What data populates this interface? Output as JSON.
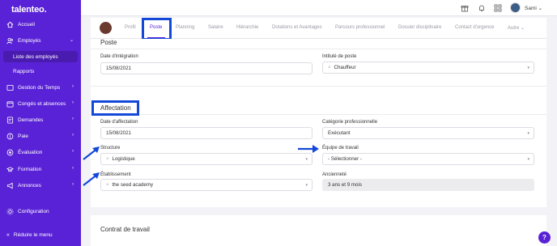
{
  "sidebar": {
    "logo": "talenteo.",
    "items": [
      {
        "label": "Accueil",
        "icon": "home-icon"
      },
      {
        "label": "Employés",
        "icon": "users-icon"
      },
      {
        "label": "Liste des employés"
      },
      {
        "label": "Rapports"
      },
      {
        "label": "Gestion du Temps",
        "icon": "clock-icon"
      },
      {
        "label": "Congés et absences",
        "icon": "calendar-icon"
      },
      {
        "label": "Demandes",
        "icon": "inbox-icon"
      },
      {
        "label": "Paie",
        "icon": "money-icon"
      },
      {
        "label": "Évaluation",
        "icon": "target-icon"
      },
      {
        "label": "Formation",
        "icon": "graduation-icon"
      },
      {
        "label": "Annonces",
        "icon": "megaphone-icon"
      },
      {
        "label": "Configuration",
        "icon": "gear-icon"
      }
    ],
    "reduce_label": "Réduire le menu"
  },
  "topbar": {
    "user_name": "Sami"
  },
  "tabs": [
    "Profil",
    "Poste",
    "Planning",
    "Salaire",
    "Hiérarchie",
    "Dotations et Avantages",
    "Parcours professionnel",
    "Dossier disciplinaire",
    "Contact d'urgence",
    "Autre"
  ],
  "active_tab": "Poste",
  "poste": {
    "title": "Poste",
    "date_integration_label": "Date d'intégration",
    "date_integration_value": "15/08/2021",
    "intitule_label": "Intitulé de poste",
    "intitule_value": "Chauffeur"
  },
  "affectation": {
    "title": "Affectation",
    "date_affectation_label": "Date d'affectation",
    "date_affectation_value": "15/08/2021",
    "categorie_label": "Catégorie professionnelle",
    "categorie_value": "Exécutant",
    "structure_label": "Structure",
    "structure_value": "Logistique",
    "equipe_label": "Équipe de travail",
    "equipe_value": "- Sélectionner -",
    "etablissement_label": "Établissement",
    "etablissement_value": "the seed academy",
    "anciennete_label": "Ancienneté",
    "anciennete_value": "3 ans et 9 mois"
  },
  "contrat": {
    "title": "Contrat de travail"
  },
  "colors": {
    "brand": "#5a22d6",
    "highlight": "#1448d8"
  }
}
